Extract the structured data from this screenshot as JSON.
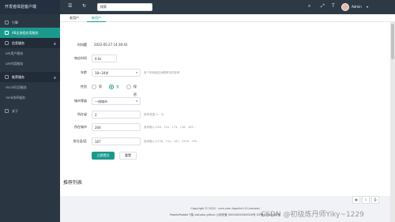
{
  "sidebar": {
    "brand": "开发者体验客户端",
    "items": [
      {
        "label": "引擎",
        "icon": "engine-icon"
      },
      {
        "label": "AB全流程应用服务",
        "icon": "ab-icon"
      },
      {
        "label": "信息服务",
        "icon": "info-icon"
      },
      {
        "label": "um用户服务"
      },
      {
        "label": "um内容服务"
      },
      {
        "label": "推荐服务",
        "icon": "recommend-icon"
      },
      {
        "label": "recall召回服务"
      },
      {
        "label": "rank排序服务"
      },
      {
        "label": "关于",
        "icon": "about-icon"
      }
    ]
  },
  "topbar": {
    "search_value": "搜索",
    "user": "Admin"
  },
  "tabs": [
    "老用户",
    "新用户"
  ],
  "form": {
    "time_label": "时间戳",
    "time_value": "2022-05-27 14:30:42",
    "latency_label": "响应时间",
    "latency_value": "0.0s",
    "age_label": "年龄",
    "age_value": "18~24岁",
    "age_hint": "各个年龄段区间概率仅供参考",
    "gender_label": "性别",
    "gender_options": [
      "男",
      "女",
      "保密"
    ],
    "city_level_label": "城市等级",
    "city_level_value": "一线城市",
    "province_label": "所在省",
    "province_value": "2",
    "province_hint": "参考范围 (1~3)",
    "city_label": "所在城市",
    "city_value": "204",
    "city_hint": "参考输入:348、204、174、116、283...",
    "county_label": "所在县/区",
    "county_value": "167",
    "county_hint": "参考输入:2136、741、167、2316、795...",
    "submit_label": "立即提交",
    "reset_label": "重置"
  },
  "recommend": {
    "title": "推荐列表"
  },
  "footer": {
    "line1": "Copyright © 2022 · ecrs.com Apache2.0 Licensed",
    "line2": "PaddlePaddle飞桨 aistudio github 公网安备 00000000000000号 ICP备00000000号"
  },
  "watermark": "CSDN @初级炼丹师Yiky~1229",
  "colors": {
    "accent": "#1b9a8c",
    "sidebar": "#2b3643"
  }
}
